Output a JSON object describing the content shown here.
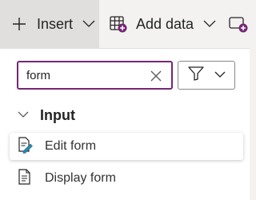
{
  "toolbar": {
    "insert_label": "Insert",
    "add_data_label": "Add data"
  },
  "search": {
    "value": "form",
    "placeholder": ""
  },
  "section": {
    "title": "Input"
  },
  "items": [
    {
      "label": "Edit form",
      "icon": "edit-form-icon",
      "selected": true
    },
    {
      "label": "Display form",
      "icon": "display-form-icon",
      "selected": false
    }
  ],
  "colors": {
    "accent": "#742774",
    "toolbar_bg": "#f3f2f1",
    "insert_active_bg": "#e1dfdd",
    "icon_purple": "#742774",
    "icon_teal": "#2b88a8"
  }
}
